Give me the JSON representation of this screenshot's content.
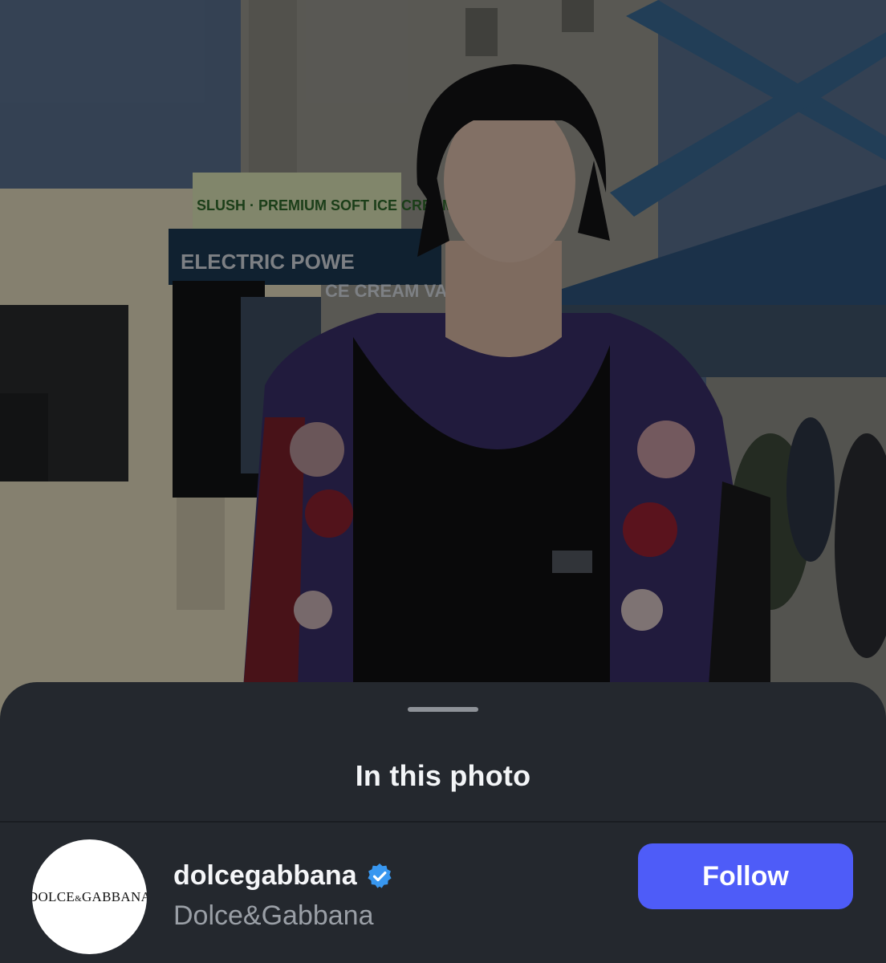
{
  "sheet": {
    "title": "In this photo"
  },
  "account": {
    "username": "dolcegabbana",
    "display_name": "Dolce&Gabbana",
    "verified": true,
    "avatar_logo_left": "DOLCE",
    "avatar_logo_amp": "&",
    "avatar_logo_right": "GABBANA",
    "follow_label": "Follow"
  },
  "photo": {
    "sign_text_1": "ELECTRIC POWE",
    "sign_text_2": "CE CREAM VAN",
    "sign_text_top": "SLUSH · PREMIUM SOFT ICE CREAM · HOTDOGS"
  },
  "colors": {
    "sheet_bg": "#24282e",
    "follow_button": "#4e5cf8",
    "verified_badge": "#3897f0",
    "secondary_text": "#9a9fa6"
  }
}
